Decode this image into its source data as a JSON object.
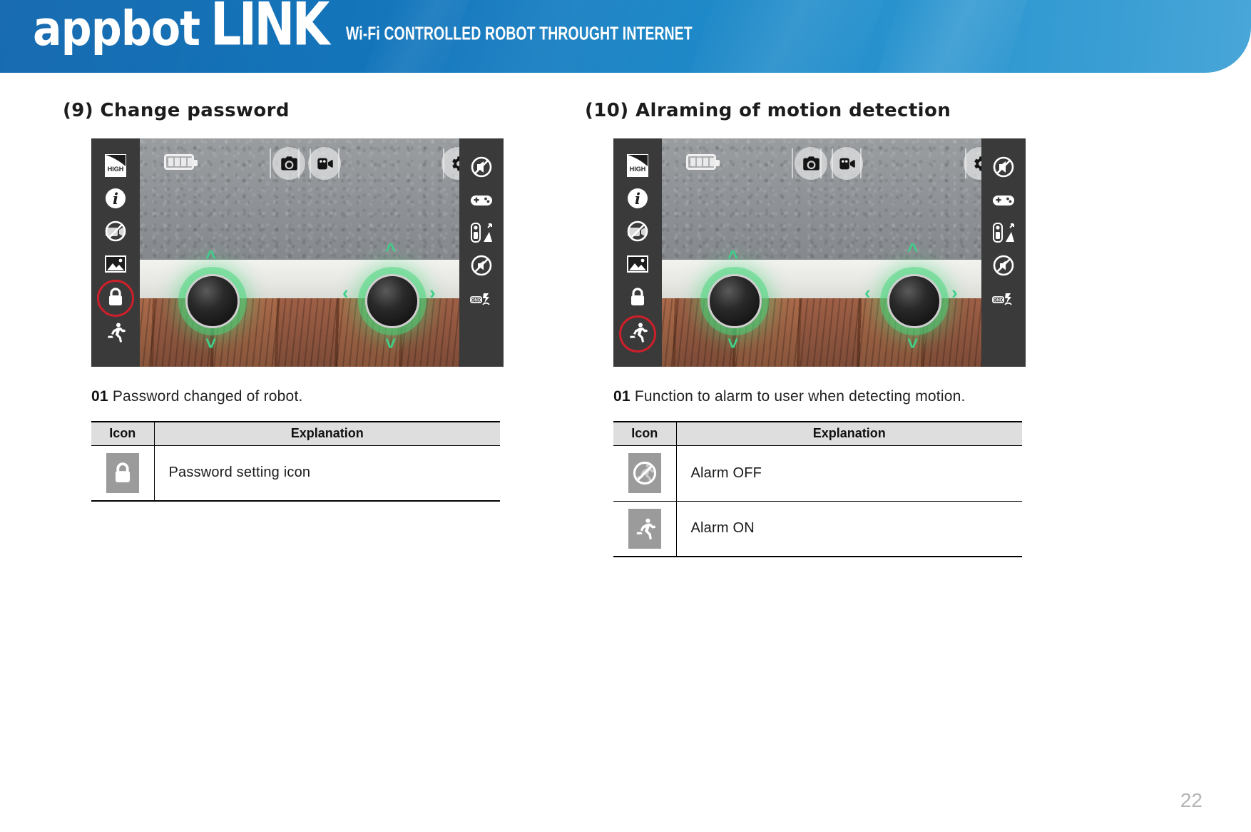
{
  "header": {
    "logo_primary": "appbot",
    "logo_secondary": "LINK",
    "tagline": "Wi-Fi CONTROLLED ROBOT THROUGHT INTERNET",
    "brand_blue_dark": "#0b63ad",
    "brand_blue_light": "#49a6d8"
  },
  "sections": [
    {
      "title": "(9) Change password",
      "caption_number": "01",
      "caption_text": "Password changed of robot.",
      "screenshot": {
        "left_rail_icons": [
          "high-quality-icon",
          "info-icon",
          "no-recording-icon",
          "gallery-icon",
          "lock-icon",
          "motion-run-icon"
        ],
        "highlighted_icon": "lock-icon",
        "highlight_color": "#cf1f2a",
        "right_rail_icons": [
          "no-sound-icon",
          "gamepad-icon",
          "robot-move-icon",
          "mute-icon",
          "charging-dock-icon"
        ],
        "top_bar_icons": [
          "battery-icon",
          "camera-icon",
          "video-icon",
          "settings-gear-icon"
        ],
        "battery_label": "HIGH"
      },
      "table": {
        "headers": [
          "Icon",
          "Explanation"
        ],
        "rows": [
          {
            "icon": "lock-icon",
            "explanation": "Password setting icon"
          }
        ]
      }
    },
    {
      "title": "(10) Alraming of motion detection",
      "caption_number": "01",
      "caption_text": "Function to alarm to user when detecting motion.",
      "screenshot": {
        "left_rail_icons": [
          "high-quality-icon",
          "info-icon",
          "no-recording-icon",
          "gallery-icon",
          "lock-icon",
          "motion-run-icon"
        ],
        "highlighted_icon": "motion-run-icon",
        "highlight_color": "#cf1f2a",
        "right_rail_icons": [
          "no-sound-icon",
          "gamepad-icon",
          "robot-move-icon",
          "mute-icon",
          "charging-dock-icon"
        ],
        "top_bar_icons": [
          "battery-icon",
          "camera-icon",
          "video-icon",
          "settings-gear-icon"
        ],
        "battery_label": "HIGH"
      },
      "table": {
        "headers": [
          "Icon",
          "Explanation"
        ],
        "rows": [
          {
            "icon": "no-motion-icon",
            "explanation": "Alarm OFF"
          },
          {
            "icon": "motion-run-icon",
            "explanation": "Alarm ON"
          }
        ]
      }
    }
  ],
  "footer": {
    "page_number": "22"
  }
}
